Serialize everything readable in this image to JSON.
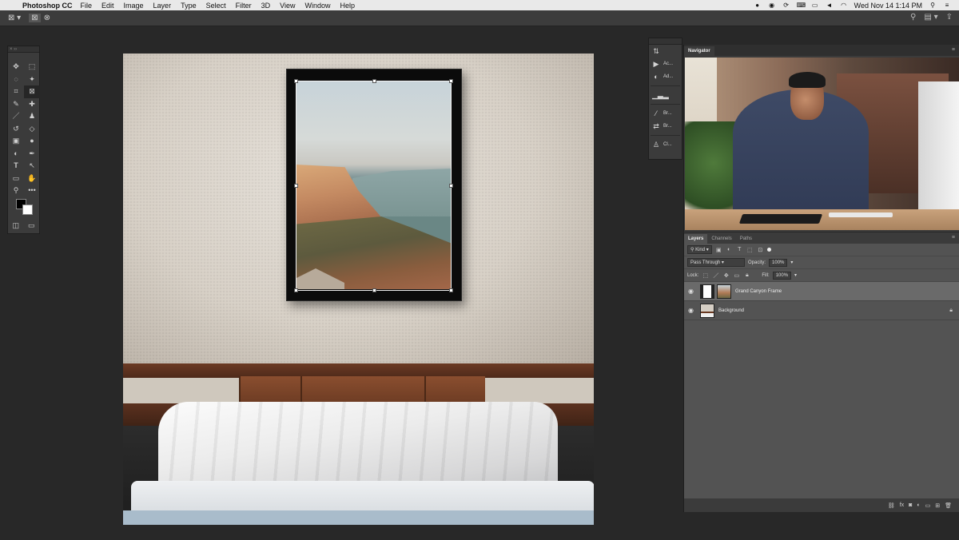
{
  "menubar": {
    "app_name": "Photoshop CC",
    "items": [
      "File",
      "Edit",
      "Image",
      "Layer",
      "Type",
      "Select",
      "Filter",
      "3D",
      "View",
      "Window",
      "Help"
    ],
    "clock": "Wed Nov 14  1:14 PM"
  },
  "toolbar": {
    "icons": [
      "transform-frame-icon",
      "frame-rect-icon",
      "frame-ellipse-icon"
    ]
  },
  "tools": {
    "items": [
      "move-tool",
      "marquee-tool",
      "lasso-tool",
      "magic-wand-tool",
      "crop-tool",
      "frame-tool",
      "eyedropper-tool",
      "healing-tool",
      "brush-tool",
      "clone-stamp-tool",
      "history-brush-tool",
      "eraser-tool",
      "gradient-tool",
      "blur-tool",
      "dodge-tool",
      "pen-tool",
      "type-tool",
      "path-select-tool",
      "rectangle-tool",
      "hand-tool",
      "zoom-tool",
      "more-tools"
    ],
    "foreground_color": "#000000",
    "background_color": "#ffffff"
  },
  "dock": {
    "items": [
      {
        "label": "",
        "icon": "properties-icon"
      },
      {
        "label": "Ac...",
        "icon": "actions-icon"
      },
      {
        "label": "Ad...",
        "icon": "adjustments-icon"
      },
      {
        "label": "",
        "icon": "histogram-icon"
      },
      {
        "label": "Br...",
        "icon": "brush-icon"
      },
      {
        "label": "Br...",
        "icon": "brush-settings-icon"
      },
      {
        "label": "Cl...",
        "icon": "clone-source-icon"
      }
    ]
  },
  "navigator": {
    "tab": "Navigator"
  },
  "layers": {
    "tabs": [
      "Layers",
      "Channels",
      "Paths"
    ],
    "filter_label": "Kind",
    "blend_mode": "Pass Through",
    "opacity_label": "Opacity:",
    "opacity_value": "100%",
    "lock_label": "Lock:",
    "fill_label": "Fill:",
    "fill_value": "100%",
    "items": [
      {
        "name": "Grand Canyon Frame",
        "selected": true
      },
      {
        "name": "Background",
        "selected": false
      }
    ]
  }
}
